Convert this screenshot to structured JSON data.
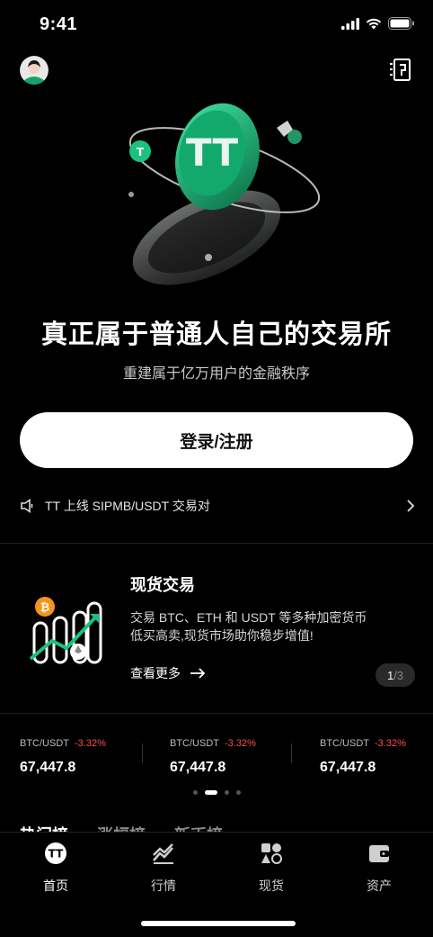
{
  "status_bar": {
    "time": "9:41"
  },
  "hero": {
    "headline": "真正属于普通人自己的交易所",
    "subheadline": "重建属于亿万用户的金融秩序",
    "login_label": "登录/注册",
    "coin_logo": "TT"
  },
  "announcement": {
    "text": "TT 上线 SIPMB/USDT 交易对"
  },
  "feature": {
    "title": "现货交易",
    "description_line1": "交易 BTC、ETH 和 USDT 等多种加密货币",
    "description_line2": "低买高卖,现货市场助你稳步增值!",
    "link_label": "查看更多",
    "page_current": "1",
    "page_total": "/3"
  },
  "tickers": [
    {
      "pair": "BTC/USDT",
      "change": "-3.32%",
      "price": "67,447.8"
    },
    {
      "pair": "BTC/USDT",
      "change": "-3.32%",
      "price": "67,447.8"
    },
    {
      "pair": "BTC/USDT",
      "change": "-3.32%",
      "price": "67,447.8"
    }
  ],
  "carousel": {
    "count": 4,
    "active_index": 1
  },
  "peek_tabs": [
    "热门榜",
    "涨幅榜",
    "新币榜"
  ],
  "bottom_nav": [
    {
      "label": "首页",
      "icon": "home-tt-icon",
      "active": true
    },
    {
      "label": "行情",
      "icon": "market-chart-icon",
      "active": false
    },
    {
      "label": "现货",
      "icon": "spot-shapes-icon",
      "active": false
    },
    {
      "label": "资产",
      "icon": "wallet-icon",
      "active": false
    }
  ],
  "colors": {
    "accent": "#19c37d",
    "negative": "#ff4d4f",
    "background": "#000000",
    "bitcoin": "#f7931a"
  }
}
